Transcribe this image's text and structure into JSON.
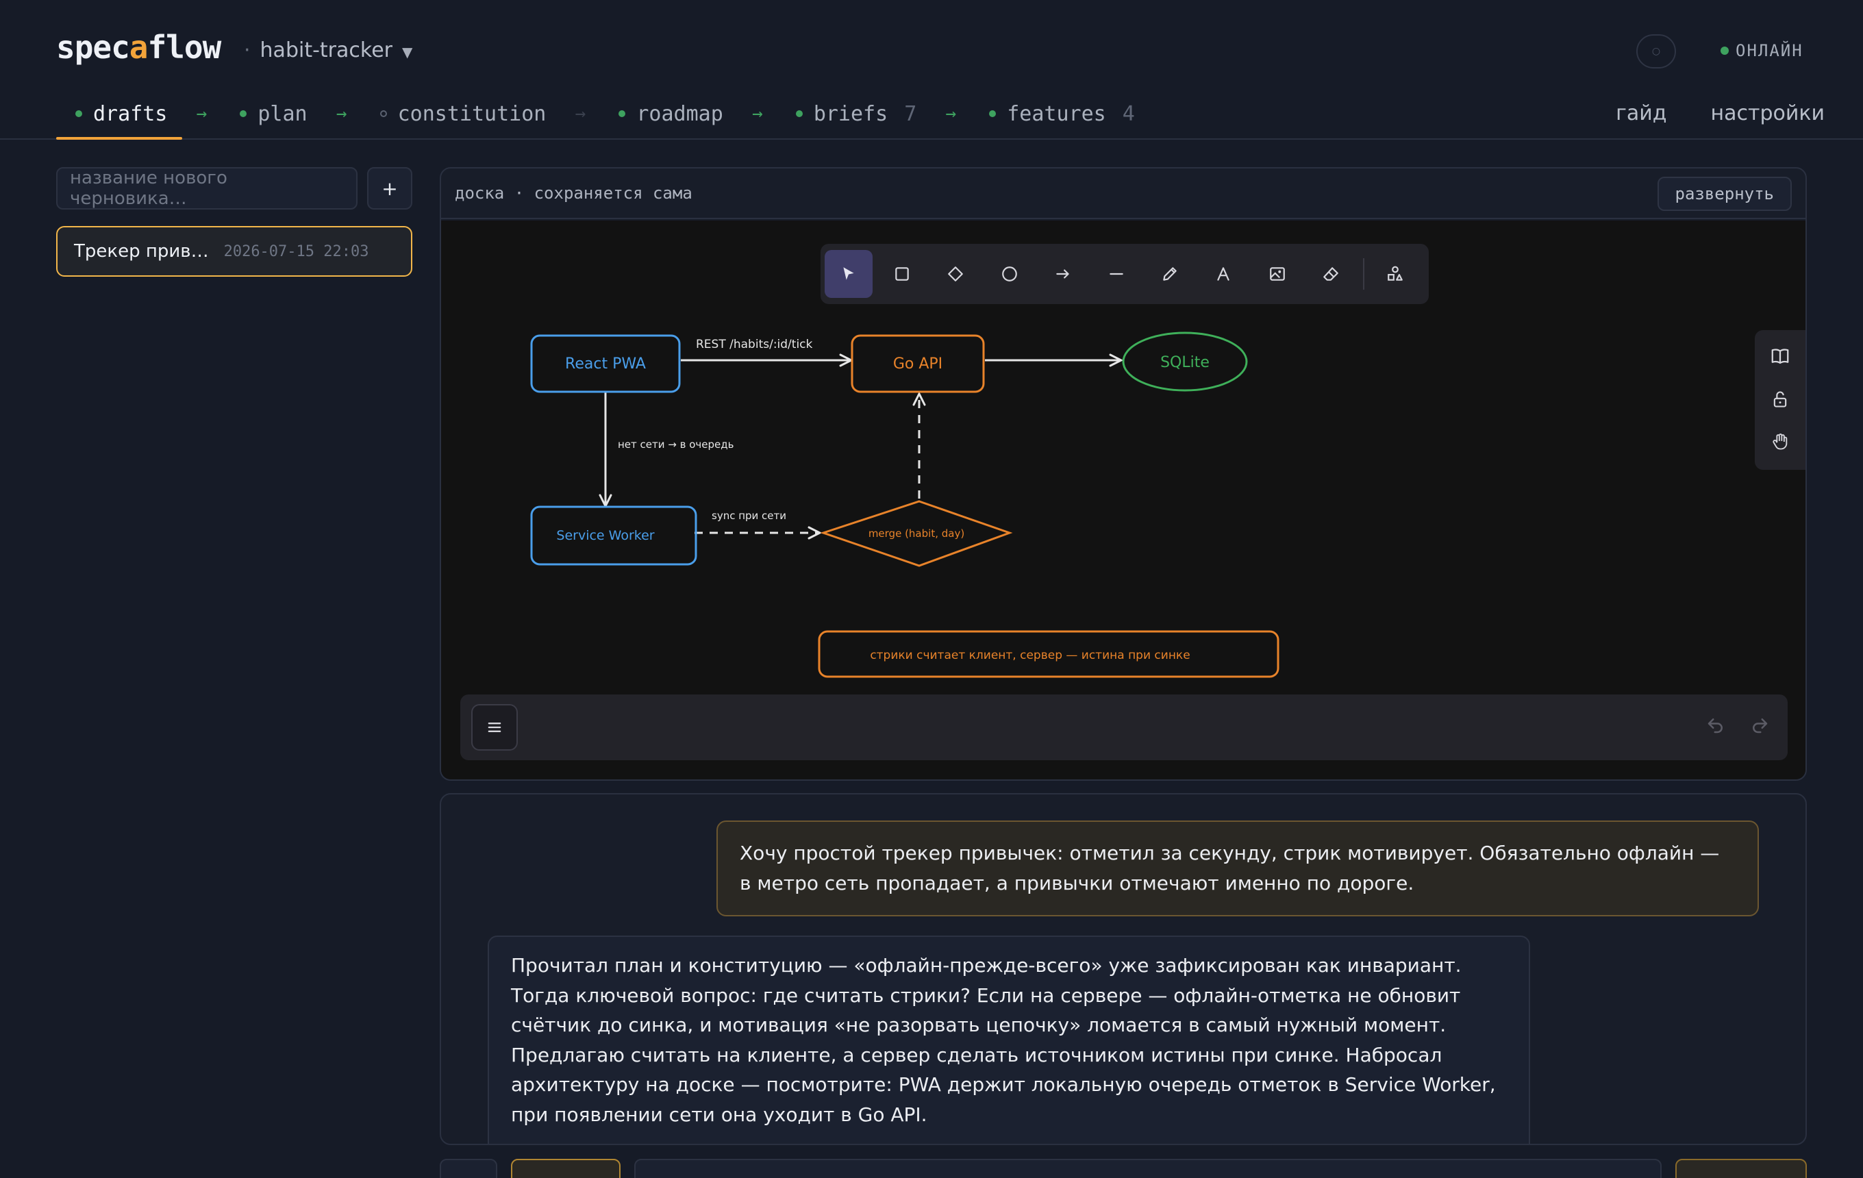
{
  "app": {
    "logo_part1": "spec",
    "logo_accent": "a",
    "logo_part2": "flow",
    "project": "habit-tracker",
    "status": "ОНЛАЙН"
  },
  "stages": [
    {
      "label": "drafts",
      "count": "",
      "done": true
    },
    {
      "label": "plan",
      "count": "",
      "done": true
    },
    {
      "label": "constitution",
      "count": "",
      "done": false
    },
    {
      "label": "roadmap",
      "count": "",
      "done": true
    },
    {
      "label": "briefs",
      "count": "7",
      "done": true
    },
    {
      "label": "features",
      "count": "4",
      "done": true
    }
  ],
  "nav": {
    "guide": "гайд",
    "settings": "настройки"
  },
  "sidebar": {
    "new_draft_placeholder": "название нового черновика…",
    "add_label": "+",
    "drafts": [
      {
        "name": "Трекер прив…",
        "date": "2026-07-15 22:03"
      }
    ]
  },
  "board": {
    "title": "доска · сохраняется сама",
    "expand_label": "развернуть",
    "tools": [
      "select-icon",
      "rectangle-icon",
      "diamond-icon",
      "ellipse-icon",
      "arrow-icon",
      "line-icon",
      "pencil-icon",
      "text-icon",
      "image-icon",
      "eraser-icon",
      "shapes-icon"
    ],
    "diagram": {
      "nodes": {
        "react": "React PWA",
        "go": "Go API",
        "sqlite": "SQLite",
        "sw": "Service Worker",
        "merge": "merge (habit, day)",
        "note": "стрики считает клиент, сервер — истина при синке"
      },
      "edges": {
        "rest": "REST /habits/:id/tick",
        "offline": "нет сети → в очередь",
        "sync": "sync при сети"
      }
    }
  },
  "colors": {
    "accent": "#f2a33a",
    "online": "#3ea25f",
    "blue": "#4a9eea",
    "orange": "#e8832a",
    "green": "#3fb05a"
  },
  "chat": {
    "user_message": "Хочу простой трекер привычек: отметил за секунду, стрик мотивирует. Обязательно офлайн — в метро сеть пропадает, а привычки отмечают именно по дороге.",
    "ai_message": "Прочитал план и конституцию — «офлайн-прежде-всего» уже зафиксирован как инвариант. Тогда ключевой вопрос: где считать стрики? Если на сервере — офлайн-отметка не обновит счётчик до синка, и мотивация «не разорвать цепочку» ломается в самый нужный момент. Предлагаю считать на клиенте, а сервер сделать источником истины при синке. Набросал архитектуру на доске — посмотрите: PWA держит локальную очередь отметок в Service Worker, при появлении сети она уходит в Go API."
  }
}
